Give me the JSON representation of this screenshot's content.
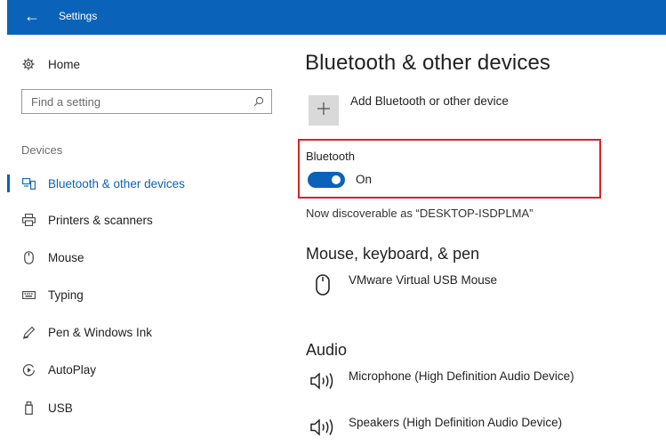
{
  "window": {
    "title": "Settings",
    "back_icon": "arrow-left-icon",
    "accent_color": "#0a63b8"
  },
  "sidebar": {
    "home_label": "Home",
    "search_placeholder": "Find a setting",
    "section_label": "Devices",
    "items": [
      {
        "label": "Bluetooth & other devices",
        "icon": "bluetooth-devices-icon",
        "active": true
      },
      {
        "label": "Printers & scanners",
        "icon": "printer-icon",
        "active": false
      },
      {
        "label": "Mouse",
        "icon": "mouse-icon",
        "active": false
      },
      {
        "label": "Typing",
        "icon": "keyboard-icon",
        "active": false
      },
      {
        "label": "Pen & Windows Ink",
        "icon": "pen-icon",
        "active": false
      },
      {
        "label": "AutoPlay",
        "icon": "autoplay-icon",
        "active": false
      },
      {
        "label": "USB",
        "icon": "usb-icon",
        "active": false
      }
    ]
  },
  "main": {
    "title": "Bluetooth & other devices",
    "add_device_label": "Add Bluetooth or other device",
    "bluetooth": {
      "label": "Bluetooth",
      "toggle_state": "On",
      "highlight_color": "#d9222a"
    },
    "discoverable_text": "Now discoverable as “DESKTOP-ISDPLMA”",
    "sections": [
      {
        "heading": "Mouse, keyboard, & pen",
        "devices": [
          {
            "name": "VMware Virtual USB Mouse",
            "icon": "mouse-icon"
          }
        ]
      },
      {
        "heading": "Audio",
        "devices": [
          {
            "name": "Microphone (High Definition Audio Device)",
            "icon": "speaker-icon"
          },
          {
            "name": "Speakers (High Definition Audio Device)",
            "icon": "speaker-icon"
          }
        ]
      }
    ]
  }
}
